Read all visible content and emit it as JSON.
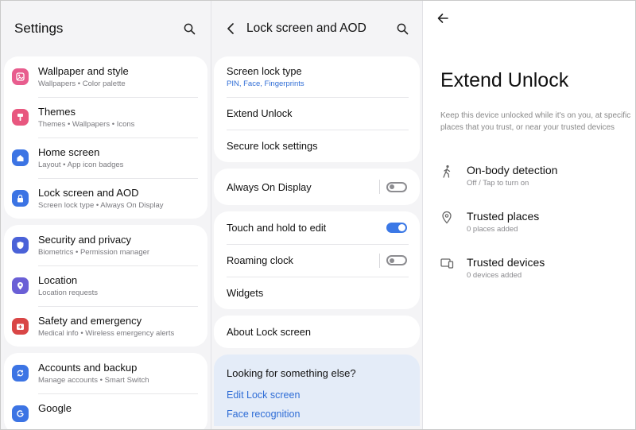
{
  "settings": {
    "title": "Settings",
    "groups": [
      [
        {
          "name": "wallpaper-and-style",
          "title": "Wallpaper and style",
          "sub": "Wallpapers  •  Color palette",
          "color": "#e85d8e"
        },
        {
          "name": "themes",
          "title": "Themes",
          "sub": "Themes  •  Wallpapers  •  Icons",
          "color": "#e8577f"
        },
        {
          "name": "home-screen",
          "title": "Home screen",
          "sub": "Layout  •  App icon badges",
          "color": "#3c74e4"
        },
        {
          "name": "lock-screen-and-aod",
          "title": "Lock screen and AOD",
          "sub": "Screen lock type  •  Always On Display",
          "color": "#3c74e4"
        }
      ],
      [
        {
          "name": "security-and-privacy",
          "title": "Security and privacy",
          "sub": "Biometrics  •  Permission manager",
          "color": "#4a62d8"
        },
        {
          "name": "location",
          "title": "Location",
          "sub": "Location requests",
          "color": "#6a5fd6"
        },
        {
          "name": "safety-and-emergency",
          "title": "Safety and emergency",
          "sub": "Medical info  •  Wireless emergency alerts",
          "color": "#d94646"
        }
      ],
      [
        {
          "name": "accounts-and-backup",
          "title": "Accounts and backup",
          "sub": "Manage accounts  •  Smart Switch",
          "color": "#3c74e4"
        },
        {
          "name": "google",
          "title": "Google",
          "sub": "",
          "color": "#3c74e4"
        }
      ]
    ]
  },
  "lock": {
    "title": "Lock screen and AOD",
    "screen_lock_type": "Screen lock type",
    "screen_lock_sub": "PIN, Face, Fingerprints",
    "extend_unlock": "Extend Unlock",
    "secure_lock": "Secure lock settings",
    "always_on": "Always On Display",
    "always_on_state": false,
    "touch_hold": "Touch and hold to edit",
    "touch_hold_state": true,
    "roaming_clock": "Roaming clock",
    "roaming_clock_state": false,
    "widgets": "Widgets",
    "about": "About Lock screen",
    "looking_title": "Looking for something else?",
    "link_edit": "Edit Lock screen",
    "link_face": "Face recognition"
  },
  "extend": {
    "title": "Extend Unlock",
    "desc": "Keep this device unlocked while it's on you, at specific places that you trust, or near your trusted devices",
    "on_body": "On-body detection",
    "on_body_sub": "Off / Tap to turn on",
    "places": "Trusted places",
    "places_sub": "0 places added",
    "devices": "Trusted devices",
    "devices_sub": "0 devices added"
  },
  "colors": {
    "accent": "#3b78e6",
    "link": "#2f6dd6"
  }
}
